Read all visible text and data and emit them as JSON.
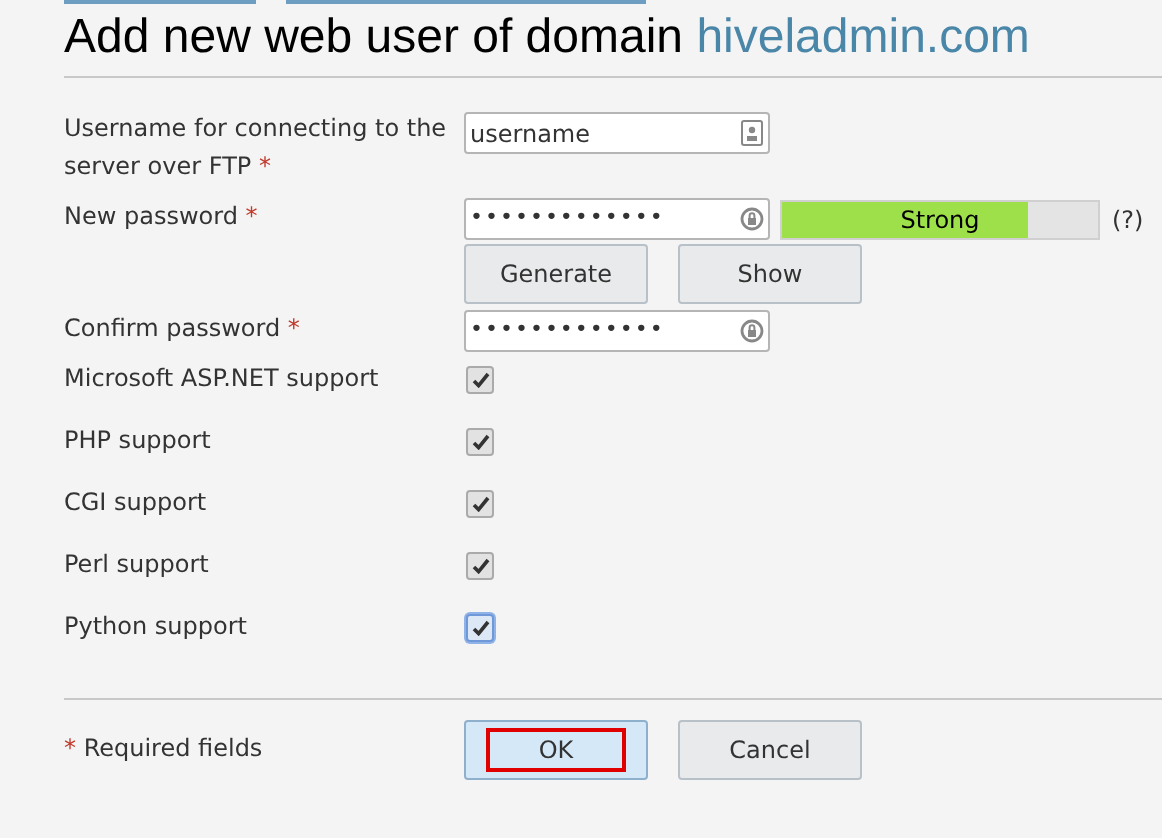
{
  "title": {
    "text": "Add new web user of domain",
    "domain": "hiveladmin.com"
  },
  "username": {
    "label": "Username for connecting to the server over FTP",
    "required_mark": "*",
    "value": "username"
  },
  "new_password": {
    "label": "New password",
    "required_mark": "*",
    "value": "•••••••••••••",
    "strength": {
      "label": "Strong",
      "level": 0.78
    },
    "help": "(?)",
    "buttons": [
      "Generate",
      "Show"
    ]
  },
  "confirm_password": {
    "label": "Confirm password",
    "required_mark": "*",
    "value": "•••••••••••••"
  },
  "options": [
    {
      "label": "Microsoft ASP.NET support",
      "checked": true,
      "focused": false
    },
    {
      "label": "PHP support",
      "checked": true,
      "focused": false
    },
    {
      "label": "CGI support",
      "checked": true,
      "focused": false
    },
    {
      "label": "Perl support",
      "checked": true,
      "focused": false
    },
    {
      "label": "Python support",
      "checked": true,
      "focused": true
    }
  ],
  "footer": {
    "required_mark": "*",
    "note": "Required fields"
  },
  "actions": [
    {
      "label": "OK",
      "kind": "primary",
      "highlighted": true
    },
    {
      "label": "Cancel",
      "kind": "default",
      "highlighted": false
    }
  ]
}
